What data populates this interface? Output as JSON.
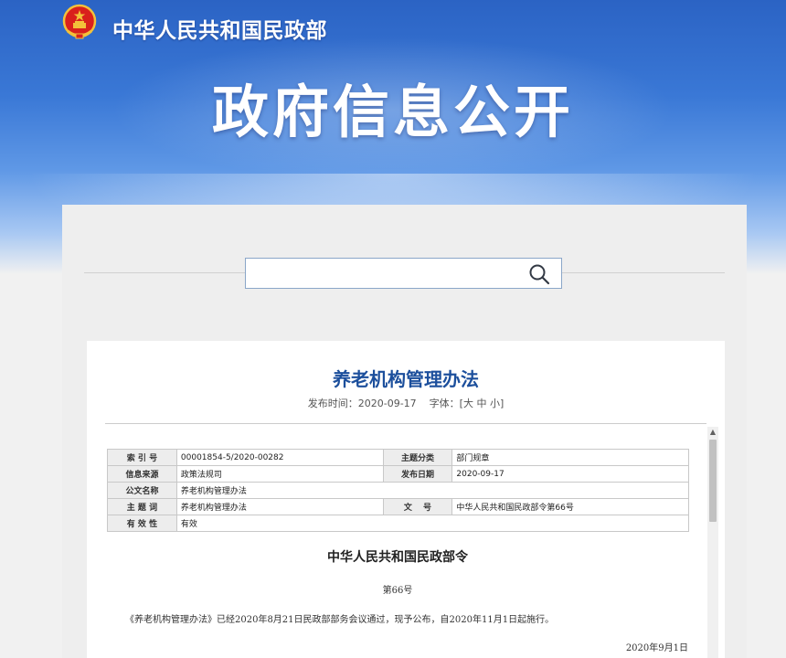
{
  "header": {
    "ministry_name": "中华人民共和国民政部",
    "banner_title": "政府信息公开"
  },
  "search": {
    "placeholder": "",
    "value": ""
  },
  "article": {
    "title": "养老机构管理办法",
    "publish_label": "发布时间：",
    "publish_date": "2020-09-17",
    "font_label": "字体：",
    "font_open": "[",
    "font_large": "大",
    "font_medium": "中",
    "font_small": "小",
    "font_close": "]"
  },
  "info_table": {
    "rows": [
      {
        "l1": "索 引 号",
        "v1": "00001854-5/2020-00282",
        "l2": "主题分类",
        "v2": "部门规章"
      },
      {
        "l1": "信息来源",
        "v1": "政策法规司",
        "l2": "发布日期",
        "v2": "2020-09-17"
      },
      {
        "l1": "公文名称",
        "v1": "养老机构管理办法"
      },
      {
        "l1": "主 题 词",
        "v1": "养老机构管理办法",
        "l2": "文　 号",
        "v2": "中华人民共和国民政部令第66号"
      },
      {
        "l1": "有 效 性",
        "v1": "有效"
      }
    ]
  },
  "document": {
    "heading": "中华人民共和国民政部令",
    "number": "第66号",
    "body": "《养老机构管理办法》已经2020年8月21日民政部部务会议通过，现予公布，自2020年11月1日起施行。",
    "date": "2020年9月1日"
  },
  "colors": {
    "banner_blue": "#2b63c4",
    "title_blue": "#1c4f9c"
  }
}
